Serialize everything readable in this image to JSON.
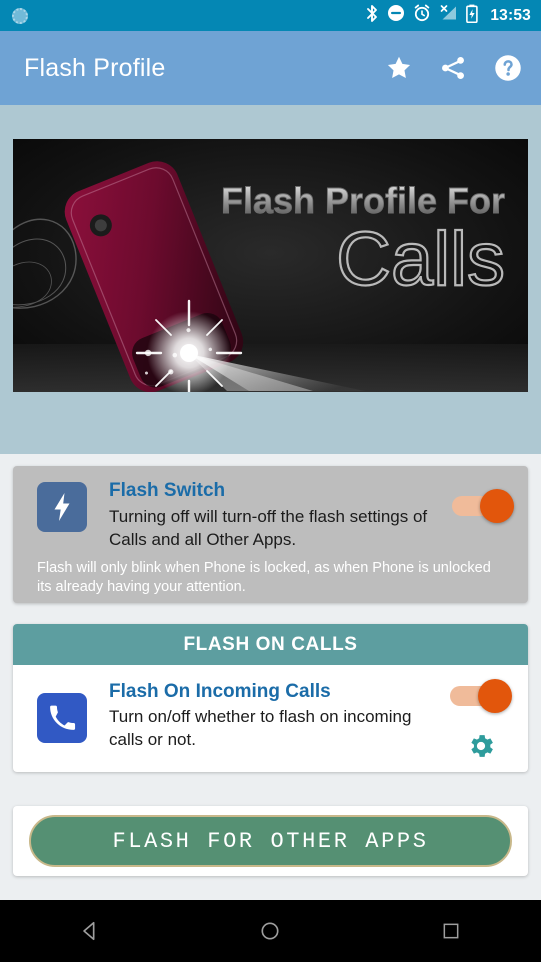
{
  "status_bar": {
    "time": "13:53",
    "notification_icon": "sync-circle-icon",
    "icons": [
      "bluetooth-icon",
      "do-not-disturb-icon",
      "alarm-icon",
      "signal-no-service-icon",
      "battery-charging-icon"
    ],
    "background_color": "#0487b4"
  },
  "app_bar": {
    "title": "Flash Profile",
    "background_color": "#6fa3d4",
    "actions": [
      {
        "name": "rate-star-icon",
        "label": "Rate"
      },
      {
        "name": "share-icon",
        "label": "Share"
      },
      {
        "name": "help-icon",
        "label": "Help"
      }
    ]
  },
  "hero": {
    "line1": "Flash Profile For",
    "line2": "Calls",
    "alt": "Phone with camera flash beam on dark background"
  },
  "flash_switch": {
    "icon": "flash-bolt-icon",
    "title": "Flash Switch",
    "description": "Turning off will turn-off the flash settings of Calls and all Other Apps.",
    "note": "Flash will only blink when Phone is locked, as when Phone is unlocked its already having your attention.",
    "toggle_state": "on",
    "card_color": "#bdbdbd",
    "title_color": "#1b6ca8"
  },
  "calls_section": {
    "header": "FLASH ON CALLS",
    "header_color": "#5d9ea0",
    "item": {
      "icon": "phone-handset-icon",
      "title": "Flash On Incoming Calls",
      "description": "Turn on/off whether to flash on incoming calls or not.",
      "toggle_state": "on",
      "settings_icon": "gear-icon",
      "settings_icon_color": "#2e9c9c"
    }
  },
  "other_apps": {
    "label": "FLASH FOR OTHER APPS",
    "fill_color": "#559073",
    "border_color": "#c8b88a"
  },
  "nav_bar": {
    "back": "back-triangle-icon",
    "home": "home-circle-icon",
    "recents": "recents-square-icon"
  },
  "page": {
    "background_color": "#aec8d2",
    "accent_orange": "#e2560c"
  }
}
